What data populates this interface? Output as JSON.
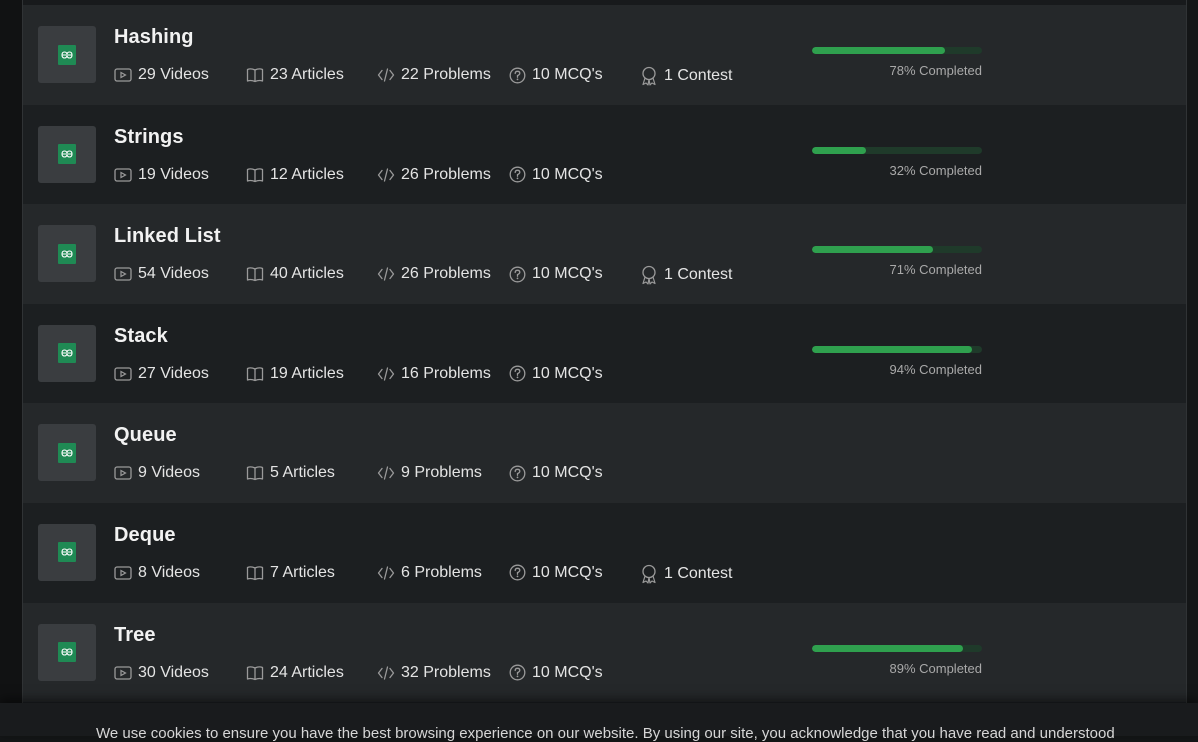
{
  "courses": [
    {
      "title": "Hashing",
      "videos": "29 Videos",
      "articles": "23 Articles",
      "problems": "22 Problems",
      "mcqs": "10 MCQ's",
      "contest": "1 Contest",
      "progress": 0.78,
      "progress_label": "78% Completed"
    },
    {
      "title": "Strings",
      "videos": "19 Videos",
      "articles": "12 Articles",
      "problems": "26 Problems",
      "mcqs": "10 MCQ's",
      "contest": null,
      "progress": 0.32,
      "progress_label": "32% Completed"
    },
    {
      "title": "Linked List",
      "videos": "54 Videos",
      "articles": "40 Articles",
      "problems": "26 Problems",
      "mcqs": "10 MCQ's",
      "contest": "1 Contest",
      "progress": 0.71,
      "progress_label": "71% Completed"
    },
    {
      "title": "Stack",
      "videos": "27 Videos",
      "articles": "19 Articles",
      "problems": "16 Problems",
      "mcqs": "10 MCQ's",
      "contest": null,
      "progress": 0.94,
      "progress_label": "94% Completed"
    },
    {
      "title": "Queue",
      "videos": "9 Videos",
      "articles": "5 Articles",
      "problems": "9 Problems",
      "mcqs": "10 MCQ's",
      "contest": null,
      "progress": null,
      "progress_label": null
    },
    {
      "title": "Deque",
      "videos": "8 Videos",
      "articles": "7 Articles",
      "problems": "6 Problems",
      "mcqs": "10 MCQ's",
      "contest": "1 Contest",
      "progress": null,
      "progress_label": null
    },
    {
      "title": "Tree",
      "videos": "30 Videos",
      "articles": "24 Articles",
      "problems": "32 Problems",
      "mcqs": "10 MCQ's",
      "contest": null,
      "progress": 0.89,
      "progress_label": "89% Completed"
    }
  ],
  "cookie_banner": {
    "text": "We use cookies to ensure you have the best browsing experience on our website. By using our site, you acknowledge that you have read and understood"
  },
  "colors": {
    "accent": "#2fa04e",
    "logo": "#1f8a54"
  },
  "icons": {
    "videos": "play-video-icon",
    "articles": "book-icon",
    "problems": "code-icon",
    "mcqs": "question-circle-icon",
    "contest": "award-ribbon-icon",
    "thumb": "gfg-logo-icon"
  }
}
